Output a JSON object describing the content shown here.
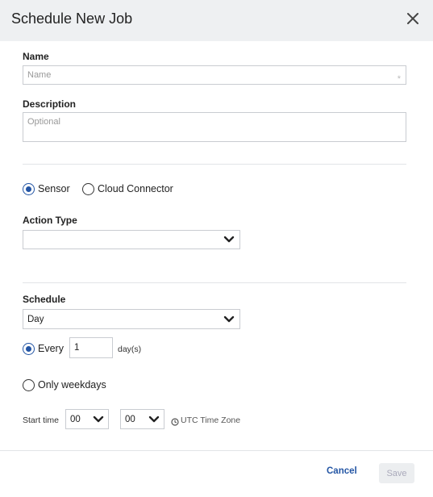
{
  "dialog": {
    "title": "Schedule New Job"
  },
  "name": {
    "label": "Name",
    "placeholder": "Name"
  },
  "description": {
    "label": "Description",
    "placeholder": "Optional"
  },
  "source": {
    "options": [
      {
        "label": "Sensor",
        "selected": true
      },
      {
        "label": "Cloud Connector",
        "selected": false
      }
    ]
  },
  "action_type": {
    "label": "Action Type",
    "value": ""
  },
  "schedule": {
    "label": "Schedule",
    "frequency": "Day",
    "every_label": "Every",
    "every_value": "1",
    "every_unit": "day(s)",
    "weekdays_label": "Only weekdays",
    "start_time_label": "Start time",
    "hour": "00",
    "minute": "00",
    "timezone": "UTC Time Zone"
  },
  "footer": {
    "cancel": "Cancel",
    "save": "Save"
  },
  "colors": {
    "accent": "#2355a4",
    "header_bg": "#eef0f2",
    "border": "#c9ccd1"
  }
}
